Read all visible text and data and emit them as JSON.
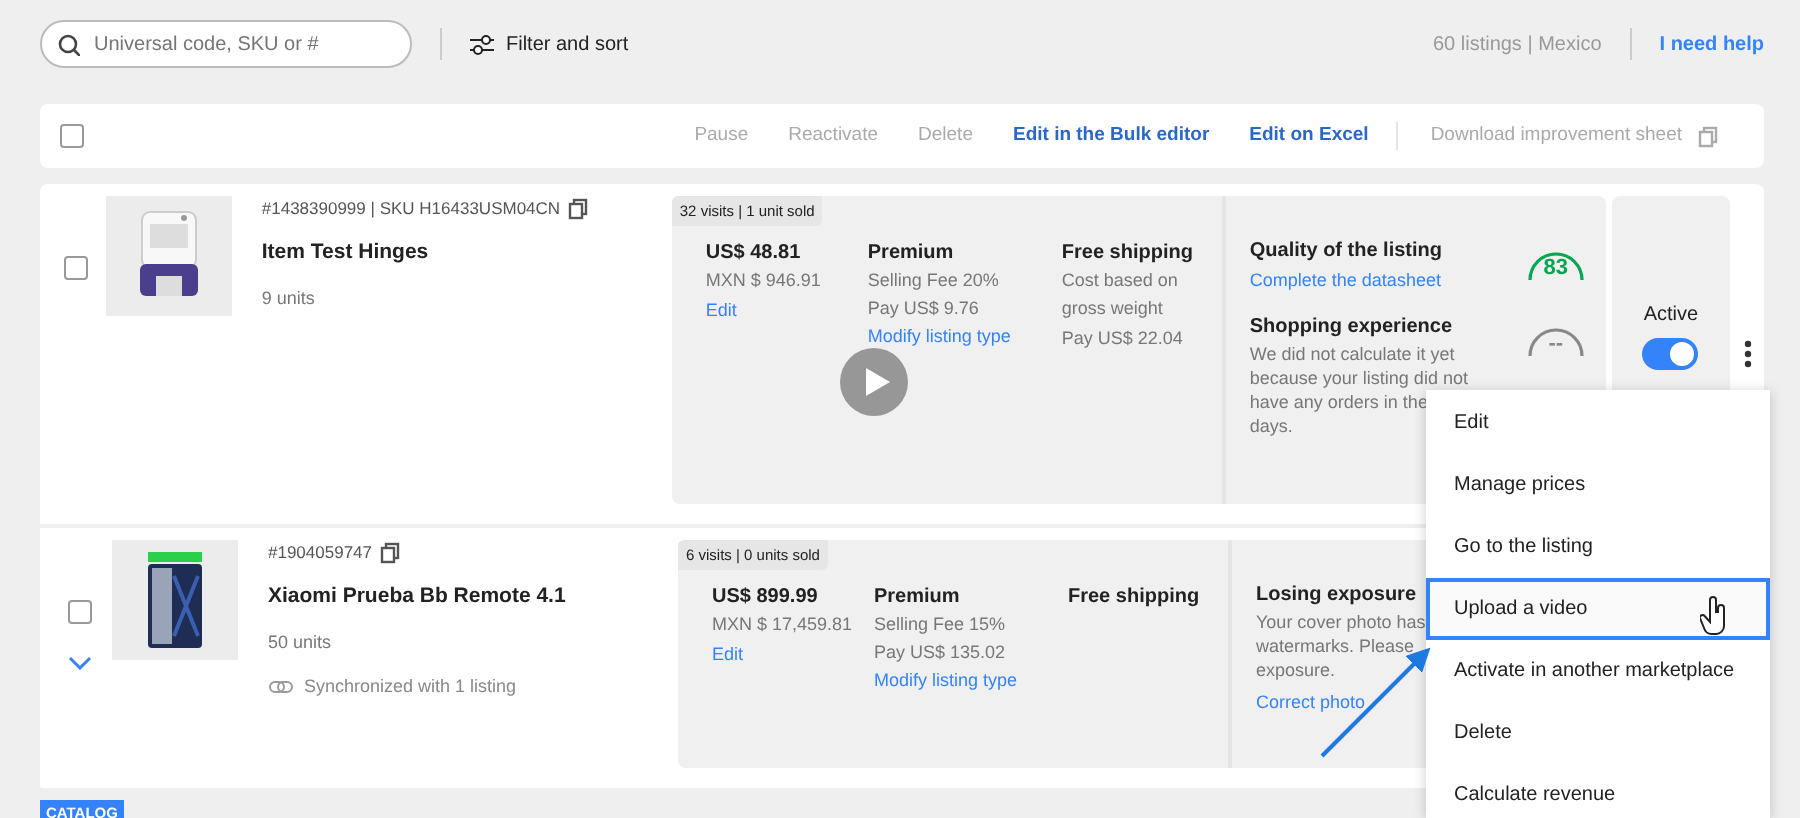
{
  "search": {
    "placeholder": "Universal code, SKU or #"
  },
  "filter_button": "Filter and sort",
  "listing_count": "60 listings | Mexico",
  "help_link": "I need help",
  "toolbar": {
    "select_all_checked": false,
    "actions": [
      {
        "label": "Pause",
        "disabled": true
      },
      {
        "label": "Reactivate",
        "disabled": true
      },
      {
        "label": "Delete",
        "disabled": true
      },
      {
        "label": "Edit in the Bulk editor",
        "disabled": false
      },
      {
        "label": "Edit on Excel",
        "disabled": false
      }
    ],
    "download": {
      "label": "Download improvement sheet",
      "disabled": true
    }
  },
  "listings": [
    {
      "checked": false,
      "id_line": "#1438390999 | SKU H16433USM04CN",
      "title": "Item Test Hinges",
      "units": "9 units",
      "stats": "32 visits | 1 unit sold",
      "price": "US$ 48.81",
      "price_local": "MXN $ 946.91",
      "price_edit": "Edit",
      "listing_type": "Premium",
      "fee": "Selling Fee 20%",
      "pay": "Pay US$ 9.76",
      "modify": "Modify listing type",
      "shipping_title": "Free shipping",
      "shipping_lines": [
        "Cost based on gross weight",
        "Pay US$ 22.04"
      ],
      "health": [
        {
          "kind": "score",
          "title": "Quality of the listing",
          "link": "Complete the datasheet",
          "score": "83"
        },
        {
          "kind": "pending",
          "title": "Shopping experience",
          "text_lines": [
            "We did not calculate it yet",
            "because your listing did not",
            "have any orders in the",
            "days."
          ],
          "score": "--"
        }
      ],
      "status": {
        "label": "Active",
        "on": true
      }
    },
    {
      "checked": false,
      "expanded": false,
      "id_line": "#1904059747",
      "title": "Xiaomi Prueba Bb Remote 4.1",
      "units": "50 units",
      "sync": "Synchronized with 1 listing",
      "stats": "6 visits | 0 units sold",
      "price": "US$ 899.99",
      "price_local": "MXN $ 17,459.81",
      "price_edit": "Edit",
      "listing_type": "Premium",
      "fee": "Selling Fee 15%",
      "pay": "Pay US$ 135.02",
      "modify": "Modify listing type",
      "shipping_title": "Free shipping",
      "health": [
        {
          "kind": "alert",
          "title": "Losing exposure",
          "text_lines": [
            "Your cover photo has",
            "watermarks. Please",
            "exposure."
          ],
          "link": "Correct photo"
        }
      ]
    }
  ],
  "menu": [
    {
      "label": "Edit",
      "selected": false
    },
    {
      "label": "Manage prices",
      "selected": false
    },
    {
      "label": "Go to the listing",
      "selected": false
    },
    {
      "label": "Upload a video",
      "selected": true
    },
    {
      "label": "Activate in another marketplace",
      "selected": false
    },
    {
      "label": "Delete",
      "selected": false
    },
    {
      "label": "Calculate revenue",
      "selected": false
    }
  ],
  "badge": "CATALOG"
}
